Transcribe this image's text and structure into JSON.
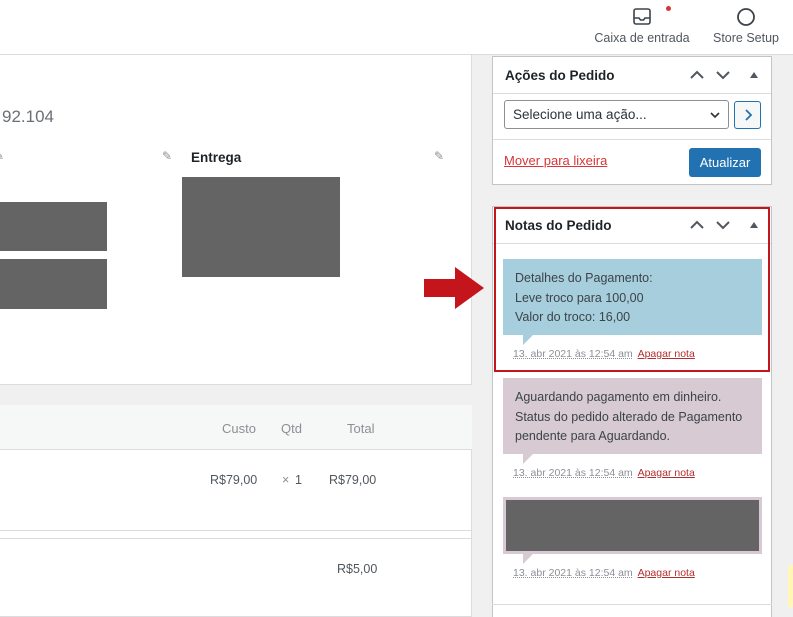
{
  "topbar": {
    "inbox_label": "Caixa de entrada",
    "store_setup_label": "Store Setup",
    "icons": [
      "inbox-icon",
      "circle-progress-icon"
    ],
    "notification_color": "#d63638"
  },
  "order": {
    "number_fragment": "92.104",
    "shipping_label": "Entrega"
  },
  "items_table": {
    "headers": {
      "cost": "Custo",
      "qty": "Qtd",
      "total": "Total"
    },
    "row": {
      "cost": "R$79,00",
      "qty_mult": "×",
      "qty": "1",
      "total": "R$79,00"
    },
    "fee_total": "R$5,00"
  },
  "order_actions": {
    "title": "Ações do Pedido",
    "select_value": "Selecione uma ação...",
    "trash_link": "Mover para lixeira",
    "update_button": "Atualizar",
    "accent_color": "#2271b1"
  },
  "order_notes": {
    "title": "Notas do Pedido",
    "notes": [
      {
        "lines": [
          "Detalhes do Pagamento:",
          "Leve troco para 100,00",
          "Valor do troco: 16,00"
        ],
        "time": "13. abr 2021 às 12:54 am",
        "delete": "Apagar nota",
        "color": "#a7cedc"
      },
      {
        "lines": [
          "Aguardando pagamento em dinheiro.",
          "Status do pedido alterado de Pagamento",
          "pendente para Aguardando."
        ],
        "time": "13. abr 2021 às 12:54 am",
        "delete": "Apagar nota",
        "color": "#d7cad2"
      },
      {
        "lines": [],
        "time": "13. abr 2021 às 12:54 am",
        "delete": "Apagar nota",
        "color": "#d7cad2"
      }
    ]
  },
  "annotation": {
    "highlight_color": "#c4141c"
  }
}
